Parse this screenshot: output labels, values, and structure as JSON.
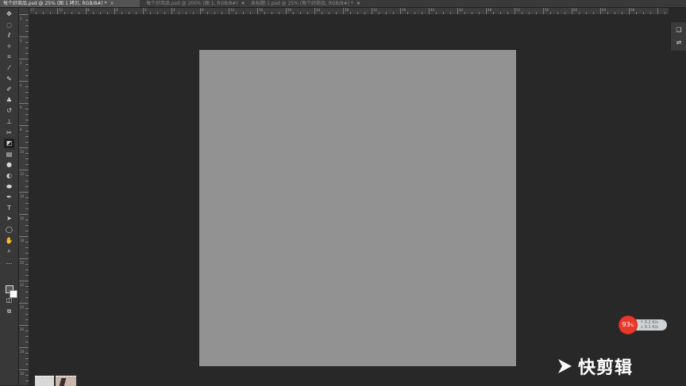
{
  "tabs": [
    {
      "label": "每个好商品.psd @ 25% (图 1 拷贝, RGB/8#) *",
      "close": "×"
    },
    {
      "label": "每个好商品.psd @ 200% (图 1, RGB/8#)",
      "close": "×"
    },
    {
      "label": "未标题-1.psd @ 25% (每个好商品, RGB/8#) *",
      "close": "×"
    }
  ],
  "ruler": {
    "top_labels": [
      "17",
      "12",
      "8",
      "4",
      "0",
      "4",
      "8",
      "12",
      "16",
      "20",
      "24",
      "28",
      "32",
      "36",
      "40",
      "44",
      "48",
      "52",
      "56",
      "60",
      "64",
      "68"
    ],
    "left_labels": [
      "2",
      "0",
      "2",
      "4",
      "6",
      "8",
      "10",
      "12",
      "14",
      "16",
      "18",
      "20",
      "22",
      "24",
      "26",
      "28",
      "30"
    ]
  },
  "toolbar": {
    "tools": [
      {
        "name": "move-tool-icon",
        "glyph": "✥"
      },
      {
        "name": "marquee-tool-icon",
        "glyph": "◌"
      },
      {
        "name": "lasso-tool-icon",
        "glyph": "ℓ"
      },
      {
        "name": "magic-wand-tool-icon",
        "glyph": "✧"
      },
      {
        "name": "crop-tool-icon",
        "glyph": "⌗"
      },
      {
        "name": "eyedropper-tool-icon",
        "glyph": "⁄"
      },
      {
        "name": "healing-brush-tool-icon",
        "glyph": "✎"
      },
      {
        "name": "brush-tool-icon",
        "glyph": "✐"
      },
      {
        "name": "clone-stamp-tool-icon",
        "glyph": "♣"
      },
      {
        "name": "history-brush-tool-icon",
        "glyph": "↺"
      },
      {
        "name": "stamp-tool-icon",
        "glyph": "⊥"
      },
      {
        "name": "art-history-brush-tool-icon",
        "glyph": "✂"
      },
      {
        "name": "eraser-tool-icon",
        "glyph": "◩"
      },
      {
        "name": "gradient-tool-icon",
        "glyph": "▤"
      },
      {
        "name": "blur-tool-icon",
        "glyph": "●"
      },
      {
        "name": "dodge-tool-icon",
        "glyph": "◐"
      },
      {
        "name": "sponge-tool-icon",
        "glyph": "⬬"
      },
      {
        "name": "pen-tool-icon",
        "glyph": "✒"
      },
      {
        "name": "type-tool-icon",
        "glyph": "T"
      },
      {
        "name": "path-selection-tool-icon",
        "glyph": "➤"
      },
      {
        "name": "shape-tool-icon",
        "glyph": "◯"
      },
      {
        "name": "hand-tool-icon",
        "glyph": "✋"
      },
      {
        "name": "zoom-tool-icon",
        "glyph": "⌕"
      },
      {
        "name": "edit-toolbar-icon",
        "glyph": "…"
      }
    ],
    "extra": [
      {
        "name": "quick-mask-icon",
        "glyph": "◫"
      },
      {
        "name": "screen-mode-icon",
        "glyph": "⧉"
      }
    ]
  },
  "right_panel": [
    {
      "name": "layers-panel-icon",
      "glyph": "❏"
    },
    {
      "name": "properties-panel-icon",
      "glyph": "⇌"
    }
  ],
  "speed_widget": {
    "percent": "93",
    "unit": "%",
    "upload": "0.2 K/s",
    "download": "0.1 K/s"
  },
  "watermark": {
    "text": "快剪辑"
  },
  "colors": {
    "workspace": "#282828",
    "canvas": "#929292",
    "badge": "#e8392a"
  }
}
